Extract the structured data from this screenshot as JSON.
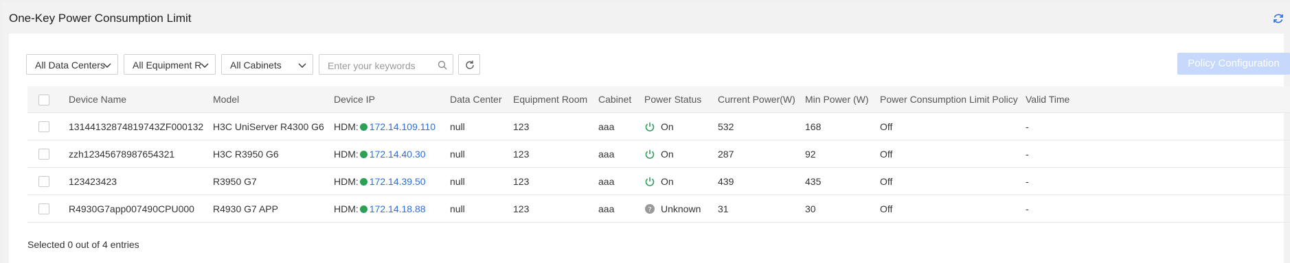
{
  "header": {
    "title": "One-Key Power Consumption Limit"
  },
  "filters": {
    "data_center": "All Data Centers",
    "equipment_room": "All Equipment Roo",
    "cabinet": "All Cabinets",
    "search_placeholder": "Enter your keywords"
  },
  "toolbar": {
    "policy_button": "Policy Configuration"
  },
  "table": {
    "columns": [
      "Device Name",
      "Model",
      "Device IP",
      "Data Center",
      "Equipment Room",
      "Cabinet",
      "Power Status",
      "Current Power(W)",
      "Min Power (W)",
      "Power Consumption Limit Policy",
      "Valid Time"
    ],
    "rows": [
      {
        "name": "13144132874819743ZF000132",
        "model": "H3C UniServer R4300 G6",
        "ip_prefix": "HDM:",
        "ip": "172.14.109.110",
        "dc": "null",
        "room": "123",
        "cabinet": "aaa",
        "status": "On",
        "status_icon": "power-on-icon",
        "current": "532",
        "min": "168",
        "policy": "Off",
        "valid": "-"
      },
      {
        "name": "zzh12345678987654321",
        "model": "H3C R3950 G6",
        "ip_prefix": "HDM:",
        "ip": "172.14.40.30",
        "dc": "null",
        "room": "123",
        "cabinet": "aaa",
        "status": "On",
        "status_icon": "power-on-icon",
        "current": "287",
        "min": "92",
        "policy": "Off",
        "valid": "-"
      },
      {
        "name": "123423423",
        "model": "R3950 G7",
        "ip_prefix": "HDM:",
        "ip": "172.14.39.50",
        "dc": "null",
        "room": "123",
        "cabinet": "aaa",
        "status": "On",
        "status_icon": "power-on-icon",
        "current": "439",
        "min": "435",
        "policy": "Off",
        "valid": "-"
      },
      {
        "name": "R4930G7app007490CPU000",
        "model": "R4930 G7 APP",
        "ip_prefix": "HDM:",
        "ip": "172.14.18.88",
        "dc": "null",
        "room": "123",
        "cabinet": "aaa",
        "status": "Unknown",
        "status_icon": "unknown-icon",
        "current": "31",
        "min": "30",
        "policy": "Off",
        "valid": "-"
      }
    ]
  },
  "footer": {
    "selection_text": "Selected 0 out of 4 entries"
  },
  "colors": {
    "accent": "#2b6de0",
    "online": "#2e9e5b",
    "status_on": "#2e9e5b",
    "status_unknown": "#999999",
    "disabled_button": "#c6d8fb"
  }
}
